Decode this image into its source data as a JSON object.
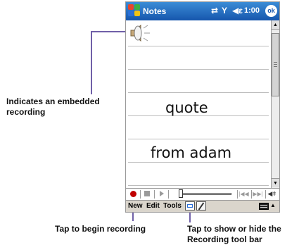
{
  "app": {
    "title": "Notes",
    "time": "1:00",
    "ok_label": "ok"
  },
  "note": {
    "lines": [
      "quote",
      "from adam"
    ]
  },
  "menu": {
    "new": "New",
    "edit": "Edit",
    "tools": "Tools"
  },
  "callouts": {
    "embedded": "Indicates an embedded recording",
    "record": "Tap to begin recording",
    "toggle": "Tap to show or hide the Recording tool bar"
  },
  "colors": {
    "titlebar": "#1656ad",
    "leader": "#7060a8",
    "record": "#c00000",
    "menubar": "#dad5cc"
  },
  "icons": [
    "windows-start-icon",
    "connectivity-icon",
    "signal-icon",
    "volume-icon",
    "speaker-icon",
    "record-icon",
    "stop-icon",
    "play-icon",
    "rewind-icon",
    "fast-forward-icon",
    "volume-slider-icon",
    "keyboard-icon",
    "recording-toolbar-icon",
    "pen-icon",
    "scroll-up-icon",
    "scroll-down-icon"
  ]
}
